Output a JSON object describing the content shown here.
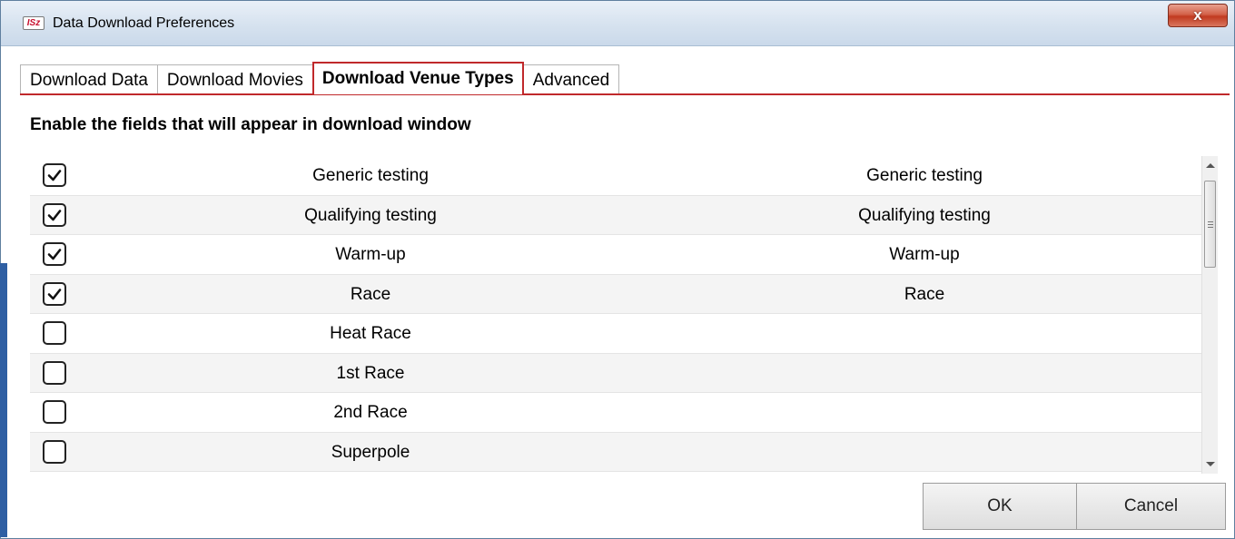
{
  "window": {
    "title": "Data Download Preferences",
    "app_icon_text": "ISz",
    "close_glyph": "x"
  },
  "tabs": [
    {
      "label": "Download Data",
      "active": false
    },
    {
      "label": "Download Movies",
      "active": false
    },
    {
      "label": "Download Venue Types",
      "active": true
    },
    {
      "label": "Advanced",
      "active": false
    }
  ],
  "heading": "Enable the fields that will appear in download window",
  "rows": [
    {
      "checked": true,
      "name": "Generic testing",
      "display": "Generic testing"
    },
    {
      "checked": true,
      "name": "Qualifying testing",
      "display": "Qualifying testing"
    },
    {
      "checked": true,
      "name": "Warm-up",
      "display": "Warm-up"
    },
    {
      "checked": true,
      "name": "Race",
      "display": "Race"
    },
    {
      "checked": false,
      "name": "Heat Race",
      "display": ""
    },
    {
      "checked": false,
      "name": "1st Race",
      "display": ""
    },
    {
      "checked": false,
      "name": "2nd Race",
      "display": ""
    },
    {
      "checked": false,
      "name": "Superpole",
      "display": ""
    }
  ],
  "buttons": {
    "ok": "OK",
    "cancel": "Cancel"
  },
  "colors": {
    "accent_red": "#c0292b",
    "close_button": "#c13a20"
  }
}
